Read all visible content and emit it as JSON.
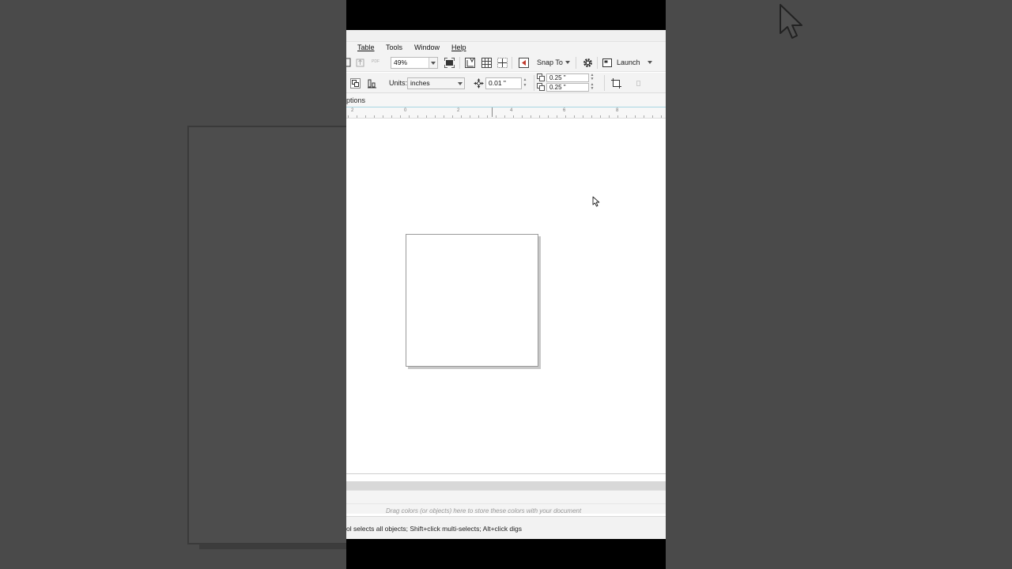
{
  "menu": {
    "table": "Table",
    "tools": "Tools",
    "window": "Window",
    "help": "Help"
  },
  "toolbar": {
    "zoom_value": "49%",
    "snap_to_label": "Snap To",
    "launch_label": "Launch",
    "pdf_icon_text": "PDF"
  },
  "property_bar": {
    "units_label": "Units:",
    "units_value": "inches",
    "nudge_value": "0.01 \"",
    "dup_x_value": "0.25 \"",
    "dup_y_value": "0.25 \""
  },
  "tab": {
    "options_label": "ptions"
  },
  "ruler": {
    "ticks": [
      "2",
      "0",
      "2",
      "4",
      "6",
      "8"
    ]
  },
  "palette": {
    "hint": "Drag colors (or objects) here to store these colors with your document"
  },
  "status": {
    "text": "ol selects all objects; Shift+click multi-selects; Alt+click digs"
  },
  "icons": {
    "big_cursor": "arrow-cursor-icon",
    "small_cursor": "arrow-cursor-icon",
    "settings": "gear-icon",
    "full_screen": "full-screen-icon",
    "nudge": "move-arrows-icon"
  },
  "colors": {
    "backdrop": "#4a4a4a",
    "ruler_accent": "#a9d6e2"
  }
}
